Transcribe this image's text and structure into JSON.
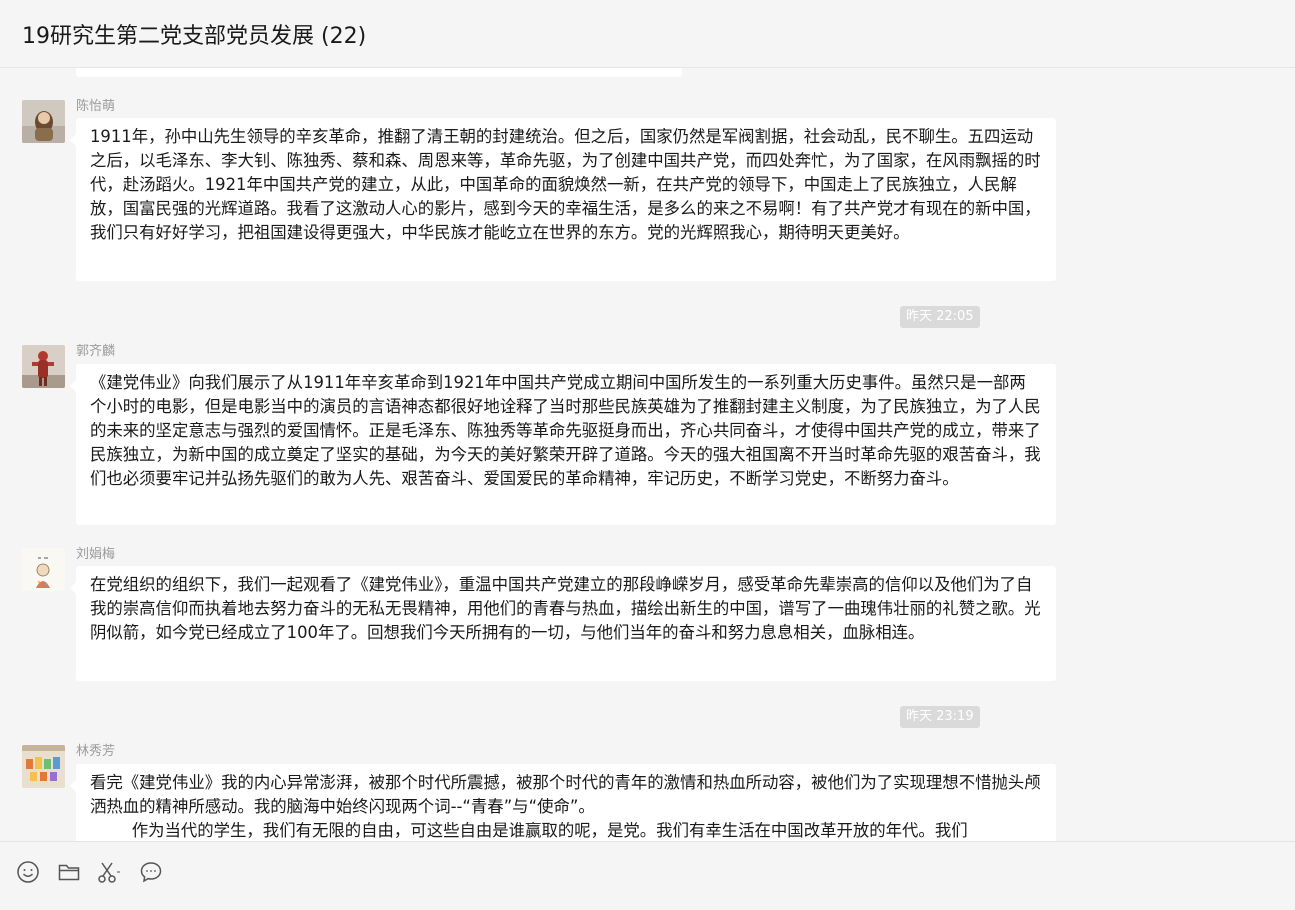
{
  "header": {
    "title": "19研究生第二党支部党员发展 (22)"
  },
  "messages": [
    {
      "sender": "陈怡萌",
      "text": "1911年，孙中山先生领导的辛亥革命，推翻了清王朝的封建统治。但之后，国家仍然是军阀割据，社会动乱，民不聊生。五四运动之后，以毛泽东、李大钊、陈独秀、蔡和森、周恩来等，革命先驱，为了创建中国共产党，而四处奔忙，为了国家，在风雨飘摇的时代，赴汤蹈火。1921年中国共产党的建立，从此，中国革命的面貌焕然一新，在共产党的领导下，中国走上了民族独立，人民解放，国富民强的光辉道路。我看了这激动人心的影片，感到今天的幸福生活，是多么的来之不易啊！有了共产党才有现在的新中国，我们只有好好学习，把祖国建设得更强大，中华民族才能屹立在世界的东方。党的光辉照我心，期待明天更美好。"
    },
    {
      "sender": "郭齐麟",
      "text": "《建党伟业》向我们展示了从1911年辛亥革命到1921年中国共产党成立期间中国所发生的一系列重大历史事件。虽然只是一部两个小时的电影，但是电影当中的演员的言语神态都很好地诠释了当时那些民族英雄为了推翻封建主义制度，为了民族独立，为了人民的未来的坚定意志与强烈的爱国情怀。正是毛泽东、陈独秀等革命先驱挺身而出，齐心共同奋斗，才使得中国共产党的成立，带来了民族独立，为新中国的成立奠定了坚实的基础，为今天的美好繁荣开辟了道路。今天的强大祖国离不开当时革命先驱的艰苦奋斗，我们也必须要牢记并弘扬先驱们的敢为人先、艰苦奋斗、爱国爱民的革命精神，牢记历史，不断学习党史，不断努力奋斗。"
    },
    {
      "sender": "刘娟梅",
      "text": "在党组织的组织下，我们一起观看了《建党伟业》，重温中国共产党建立的那段峥嵘岁月，感受革命先辈崇高的信仰以及他们为了自我的崇高信仰而执着地去努力奋斗的无私无畏精神，用他们的青春与热血，描绘出新生的中国，谱写了一曲瑰伟壮丽的礼赞之歌。光阴似箭，如今党已经成立了100年了。回想我们今天所拥有的一切，与他们当年的奋斗和努力息息相关，血脉相连。"
    },
    {
      "sender": "林秀芳",
      "text": "看完《建党伟业》我的内心异常澎湃，被那个时代所震撼，被那个时代的青年的激情和热血所动容，被他们为了实现理想不惜抛头颅洒热血的精神所感动。我的脑海中始终闪现两个词--“青春”与“使命”。\n        作为当代的学生，我们有无限的自由，可这些自由是谁赢取的呢，是党。我们有幸生活在中国改革开放的年代。我们"
    }
  ],
  "timestamps": [
    "昨天 22:05",
    "昨天 23:19"
  ],
  "toolbar": {
    "icons": [
      "emoji-icon",
      "folder-icon",
      "scissors-icon",
      "chat-bubble-icon"
    ]
  }
}
